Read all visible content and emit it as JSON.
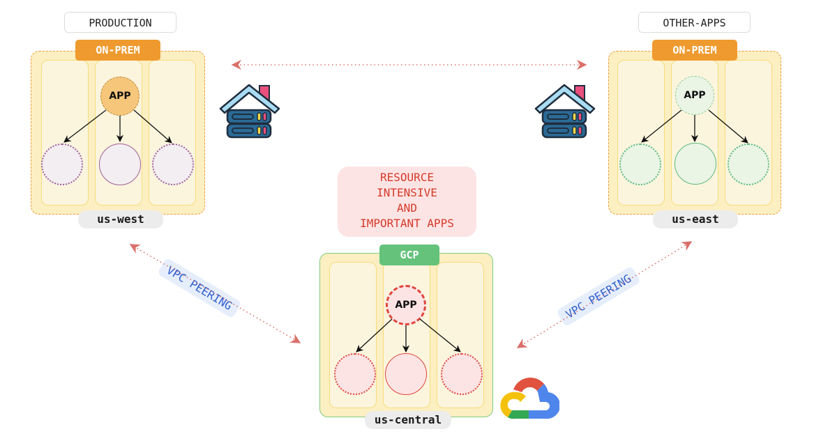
{
  "environments": {
    "production": "PRODUCTION",
    "other_apps": "OTHER-APPS"
  },
  "regions": {
    "west": {
      "tag": "ON-PREM",
      "name": "us-west",
      "app": "APP"
    },
    "east": {
      "tag": "ON-PREM",
      "name": "us-east",
      "app": "APP"
    },
    "central": {
      "tag": "GCP",
      "name": "us-central",
      "app": "APP"
    }
  },
  "note": {
    "lines": [
      "RESOURCE",
      "INTENSIVE",
      "AND",
      "IMPORTANT APPS"
    ]
  },
  "connections": {
    "left_peering": "VPC PEERING",
    "right_peering": "VPC PEERING"
  },
  "icons": {
    "on_prem_server": "home-server-icon",
    "gcp_logo": "google-cloud-icon"
  },
  "colors": {
    "onprem_tag": "#ef9a2e",
    "gcp_tag": "#64c27a",
    "note_text": "#d63a2a",
    "peering_text": "#2f5fcf",
    "arrow": "#d9706a"
  }
}
